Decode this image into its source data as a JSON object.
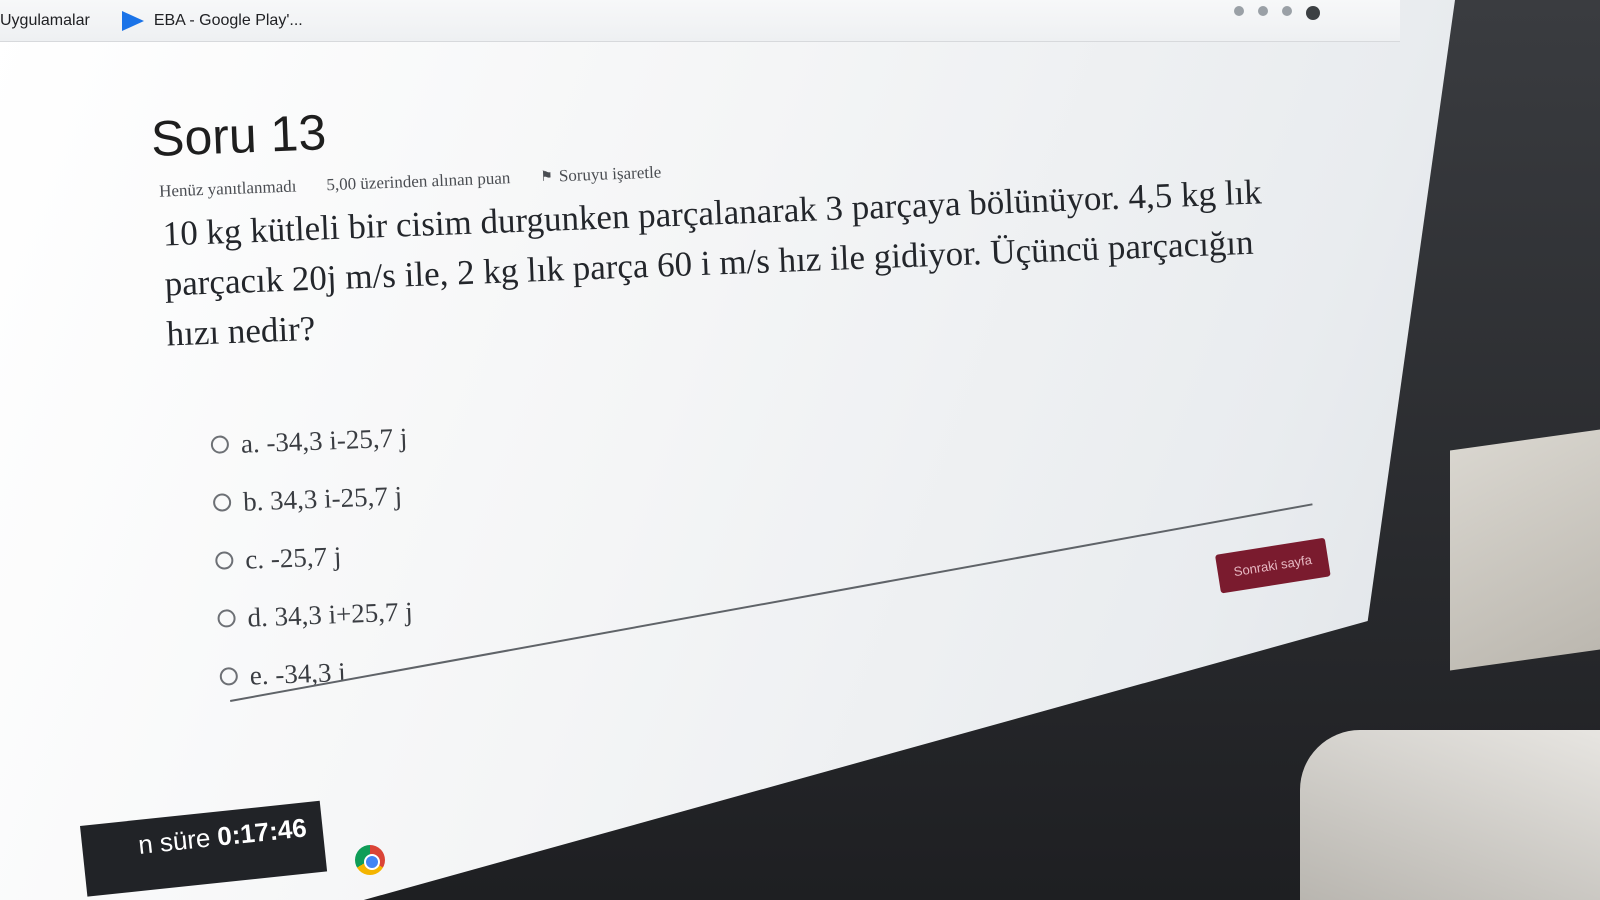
{
  "bookmarks": [
    {
      "label": "Uygulamalar"
    },
    {
      "label": "EBA - Google Play'..."
    }
  ],
  "question": {
    "title": "Soru 13",
    "status": "Henüz yanıtlanmadı",
    "points": "5,00 üzerinden alınan puan",
    "flag_label": "Soruyu işaretle",
    "text": "10 kg kütleli bir cisim durgunken parçalanarak 3 parçaya bölünüyor. 4,5 kg lık parçacık 20j m/s ile, 2 kg lık parça 60 i m/s hız ile gidiyor. Üçüncü parçacığın hızı nedir?"
  },
  "answers": [
    {
      "label": "a. -34,3 i-25,7 j"
    },
    {
      "label": "b. 34,3 i-25,7 j"
    },
    {
      "label": "c. -25,7 j"
    },
    {
      "label": "d. 34,3 i+25,7 j"
    },
    {
      "label": "e. -34,3 i"
    }
  ],
  "next_button": "Sonraki sayfa",
  "timer": {
    "label": "n süre ",
    "value": "0:17:46"
  },
  "colors": {
    "next_button": "#7a1b2e",
    "timer_bg": "#212327"
  }
}
